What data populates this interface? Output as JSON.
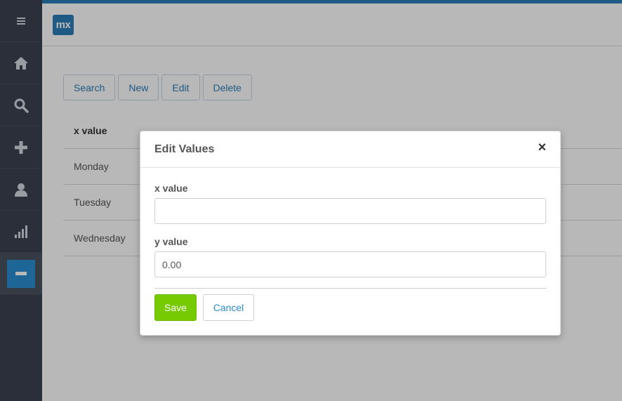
{
  "sidebar": {
    "items": [
      {
        "icon": "menu-icon"
      },
      {
        "icon": "home-icon"
      },
      {
        "icon": "search-icon"
      },
      {
        "icon": "plus-icon"
      },
      {
        "icon": "user-icon"
      },
      {
        "icon": "chart-icon"
      },
      {
        "icon": "minus-icon",
        "active": true
      }
    ]
  },
  "header": {
    "logo_text": "mx"
  },
  "toolbar": {
    "search_label": "Search",
    "new_label": "New",
    "edit_label": "Edit",
    "delete_label": "Delete"
  },
  "grid": {
    "column_header": "x value",
    "rows": [
      "Monday",
      "Tuesday",
      "Wednesday"
    ]
  },
  "modal": {
    "title": "Edit Values",
    "close_glyph": "×",
    "x_label": "x value",
    "x_value": "",
    "y_label": "y value",
    "y_value": "0.00",
    "save_label": "Save",
    "cancel_label": "Cancel"
  },
  "colors": {
    "brand": "#2a7db8",
    "save": "#76ca02",
    "sidebar": "#3b4250"
  }
}
